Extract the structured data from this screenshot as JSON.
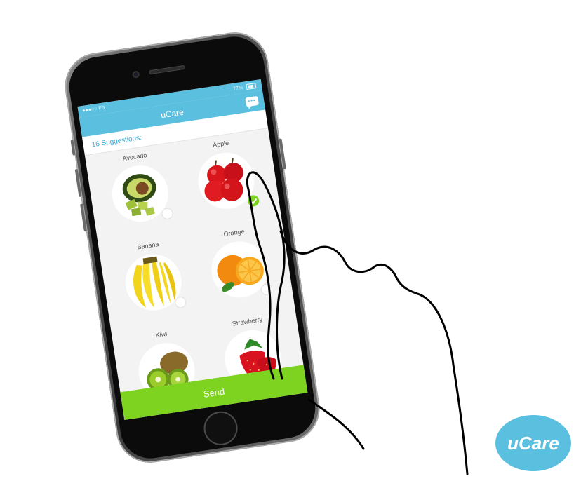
{
  "status_bar": {
    "carrier": "●●●○○ FB",
    "battery": "77%"
  },
  "nav": {
    "title": "uCare",
    "chat_icon": "chat-bubble-icon"
  },
  "suggestions": {
    "label": "16 Suggestions:"
  },
  "fruits": [
    {
      "name": "Avocado",
      "selected": false
    },
    {
      "name": "Apple",
      "selected": true
    },
    {
      "name": "Banana",
      "selected": false
    },
    {
      "name": "Orange",
      "selected": false
    },
    {
      "name": "Kiwi",
      "selected": false
    },
    {
      "name": "Strawberry",
      "selected": false
    }
  ],
  "send_button": {
    "label": "Send"
  },
  "logo": {
    "text": "uCare"
  },
  "colors": {
    "accent": "#5bc0e0",
    "send": "#7ed321",
    "check": "#7ed321"
  }
}
